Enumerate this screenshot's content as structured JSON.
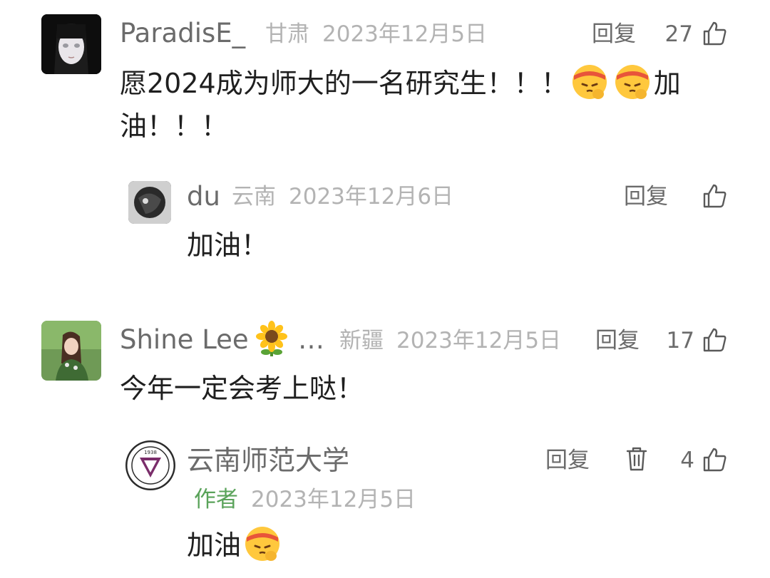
{
  "comments": [
    {
      "name": "ParadisE_",
      "location": "甘肃",
      "date": "2023年12月5日",
      "reply_label": "回复",
      "likes": "27",
      "text_part1": "愿2024成为师大的一名研究生！！！",
      "text_part2": "加",
      "text_part3": "油！！！",
      "avatar_icon": "anime-girl-avatar"
    },
    {
      "name": "du",
      "location": "云南",
      "date": "2023年12月6日",
      "reply_label": "回复",
      "likes": "",
      "text": "加油！",
      "avatar_icon": "dark-photo-avatar"
    },
    {
      "name": "Shine Lee",
      "name_suffix": "…",
      "location": "新疆",
      "date": "2023年12月5日",
      "reply_label": "回复",
      "likes": "17",
      "text": "今年一定会考上哒！",
      "avatar_icon": "girl-photo-avatar",
      "name_emoji": "sunflower-icon"
    },
    {
      "name": "云南师范大学",
      "author_tag": "作者",
      "date": "2023年12月5日",
      "reply_label": "回复",
      "likes": "4",
      "text": "加油",
      "avatar_icon": "university-logo-avatar",
      "logo_year": "1938"
    }
  ],
  "colors": {
    "name": "#6b6b6b",
    "meta": "#b3b3b3",
    "author": "#5aa35a",
    "body": "#1f1f1f"
  }
}
